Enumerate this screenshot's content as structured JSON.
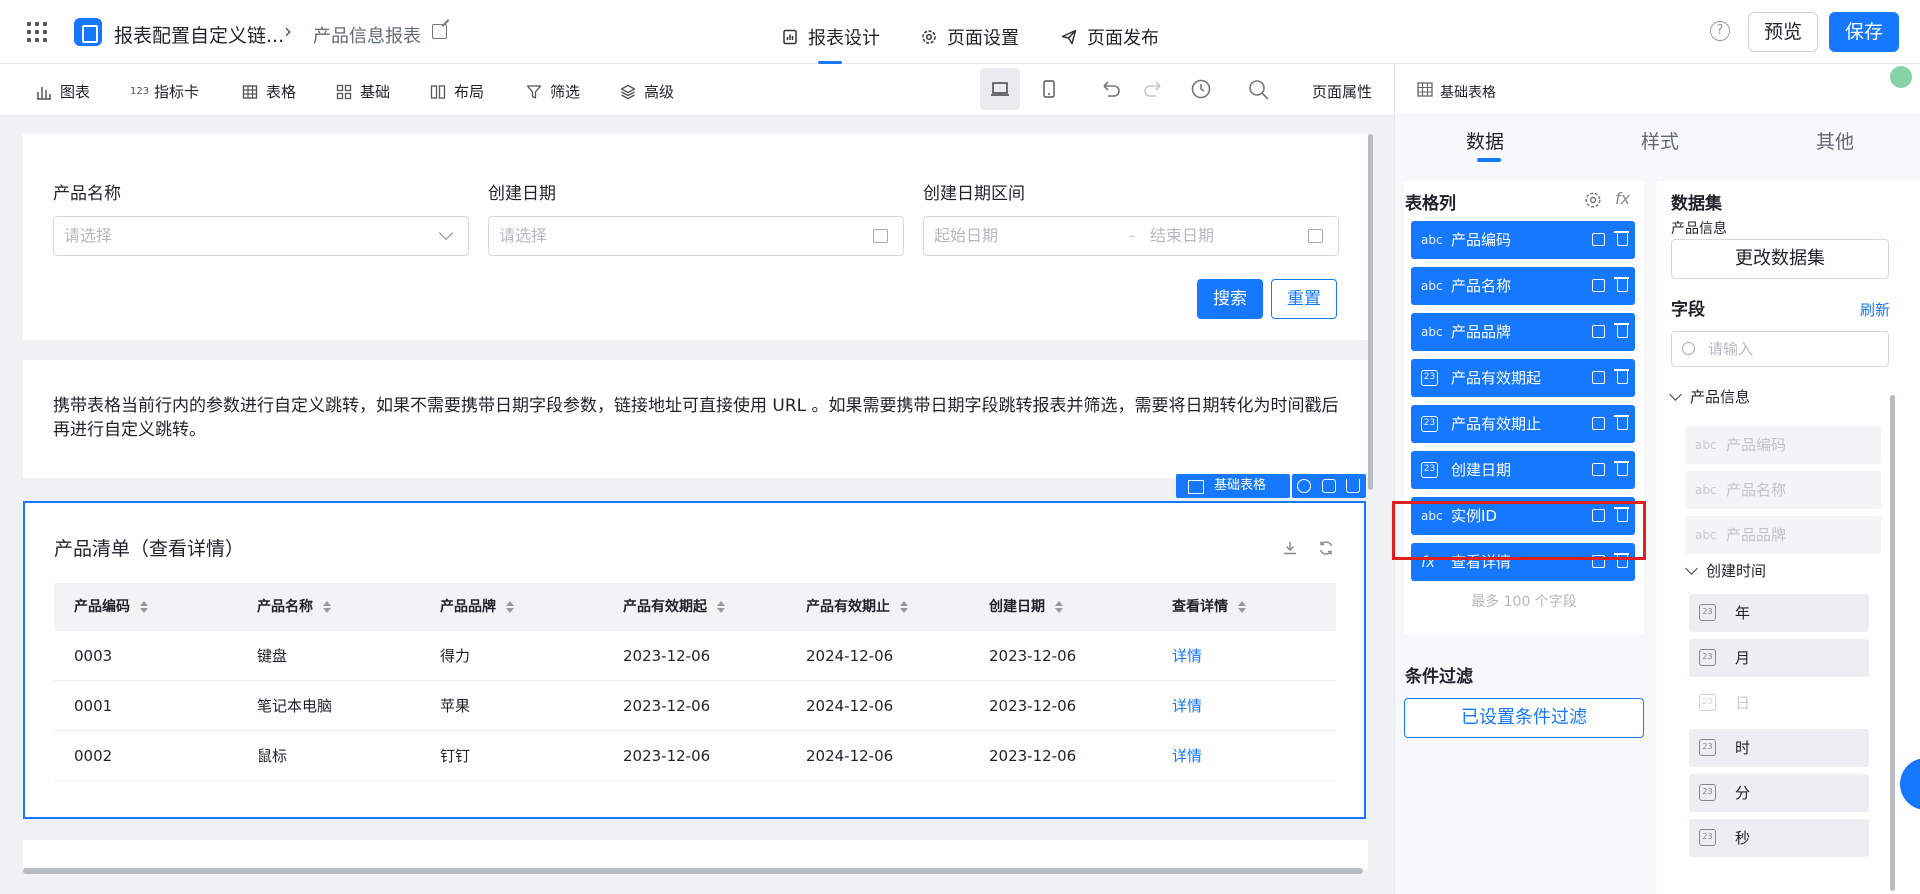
{
  "app": {
    "name": "报表配置自定义链...",
    "page_name": "产品信息报表"
  },
  "top_tabs": [
    {
      "label": "报表设计",
      "icon": "report-design-icon"
    },
    {
      "label": "页面设置",
      "icon": "gear-icon"
    },
    {
      "label": "页面发布",
      "icon": "send-icon"
    }
  ],
  "actions": {
    "help": "?",
    "preview": "预览",
    "save": "保存"
  },
  "toolbar": {
    "items": [
      "图表",
      "指标卡",
      "表格",
      "基础",
      "布局",
      "筛选",
      "高级"
    ],
    "page_props": "页面属性"
  },
  "filters": {
    "product_name": {
      "label": "产品名称",
      "placeholder": "请选择"
    },
    "create_date": {
      "label": "创建日期",
      "placeholder": "请选择"
    },
    "date_range": {
      "label": "创建日期区间",
      "start": "起始日期",
      "sep": "-",
      "end": "结束日期"
    },
    "search": "搜索",
    "reset": "重置"
  },
  "description": "携带表格当前行内的参数进行自定义跳转，如果不需要携带日期字段参数，链接地址可直接使用 URL 。如果需要携带日期字段跳转报表并筛选，需要将日期转化为时间戳后再进行自定义跳转。",
  "table": {
    "title": "产品清单（查看详情）",
    "selected_tag": "基础表格",
    "columns": [
      "产品编码",
      "产品名称",
      "产品品牌",
      "产品有效期起",
      "产品有效期止",
      "创建日期",
      "查看详情"
    ],
    "rows": [
      [
        "0003",
        "键盘",
        "得力",
        "2023-12-06",
        "2024-12-06",
        "2023-12-06",
        "详情"
      ],
      [
        "0001",
        "笔记本电脑",
        "苹果",
        "2023-12-06",
        "2024-12-06",
        "2023-12-06",
        "详情"
      ],
      [
        "0002",
        "鼠标",
        "钉钉",
        "2023-12-06",
        "2024-12-06",
        "2023-12-06",
        "详情"
      ]
    ]
  },
  "right_panel": {
    "component": "基础表格",
    "tabs": [
      "数据",
      "样式",
      "其他"
    ],
    "columns_title": "表格列",
    "columns": [
      {
        "type": "abc",
        "name": "产品编码"
      },
      {
        "type": "abc",
        "name": "产品名称"
      },
      {
        "type": "abc",
        "name": "产品品牌"
      },
      {
        "type": "date",
        "name": "产品有效期起"
      },
      {
        "type": "date",
        "name": "产品有效期止"
      },
      {
        "type": "date",
        "name": "创建日期"
      },
      {
        "type": "abc",
        "name": "实例ID"
      },
      {
        "type": "fx",
        "name": "查看详情"
      }
    ],
    "max_note": "最多 100 个字段",
    "filter_title": "条件过滤",
    "filter_button": "已设置条件过滤",
    "dataset_title": "数据集",
    "dataset_name": "产品信息",
    "change_dataset": "更改数据集",
    "fields_title": "字段",
    "refresh": "刷新",
    "search_placeholder": "请输入",
    "tree": {
      "group": "产品信息",
      "fields": [
        "产品编码",
        "产品名称",
        "产品品牌"
      ],
      "time_group": "创建时间",
      "time_fields": [
        "年",
        "月",
        "日",
        "时",
        "分",
        "秒"
      ]
    }
  }
}
